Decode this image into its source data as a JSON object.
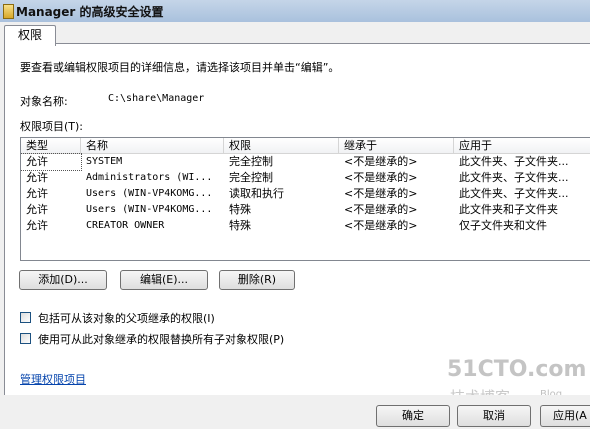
{
  "window": {
    "title": "Manager 的高级安全设置"
  },
  "tabs": [
    {
      "label": "权限"
    }
  ],
  "main": {
    "instruction": "要查看或编辑权限项目的详细信息，请选择该项目并单击“编辑”。",
    "object_name_label": "对象名称:",
    "object_name_value": "C:\\share\\Manager",
    "permission_entries_label": "权限项目(T):"
  },
  "table": {
    "columns": [
      "类型",
      "名称",
      "权限",
      "继承于",
      "应用于"
    ],
    "rows": [
      [
        "允许",
        "SYSTEM",
        "完全控制",
        "<不是继承的>",
        "此文件夹、子文件夹..."
      ],
      [
        "允许",
        "Administrators (WI...",
        "完全控制",
        "<不是继承的>",
        "此文件夹、子文件夹..."
      ],
      [
        "允许",
        "Users (WIN-VP4KOMG...",
        "读取和执行",
        "<不是继承的>",
        "此文件夹、子文件夹..."
      ],
      [
        "允许",
        "Users (WIN-VP4KOMG...",
        "特殊",
        "<不是继承的>",
        "此文件夹和子文件夹"
      ],
      [
        "允许",
        "CREATOR OWNER",
        "特殊",
        "<不是继承的>",
        "仅子文件夹和文件"
      ]
    ]
  },
  "buttons": {
    "add": "添加(D)...",
    "edit": "编辑(E)...",
    "remove": "删除(R)"
  },
  "checkboxes": {
    "include_inheritable": "包括可从该对象的父项继承的权限(I)",
    "replace_child": "使用可从此对象继承的权限替换所有子对象权限(P)"
  },
  "link": {
    "manage": "管理权限项目"
  },
  "dialog_buttons": {
    "ok": "确定",
    "cancel": "取消",
    "apply": "应用(A"
  },
  "watermark": {
    "site": "51CTO.com",
    "tagline": "技术博客",
    "blog": "Blog"
  }
}
